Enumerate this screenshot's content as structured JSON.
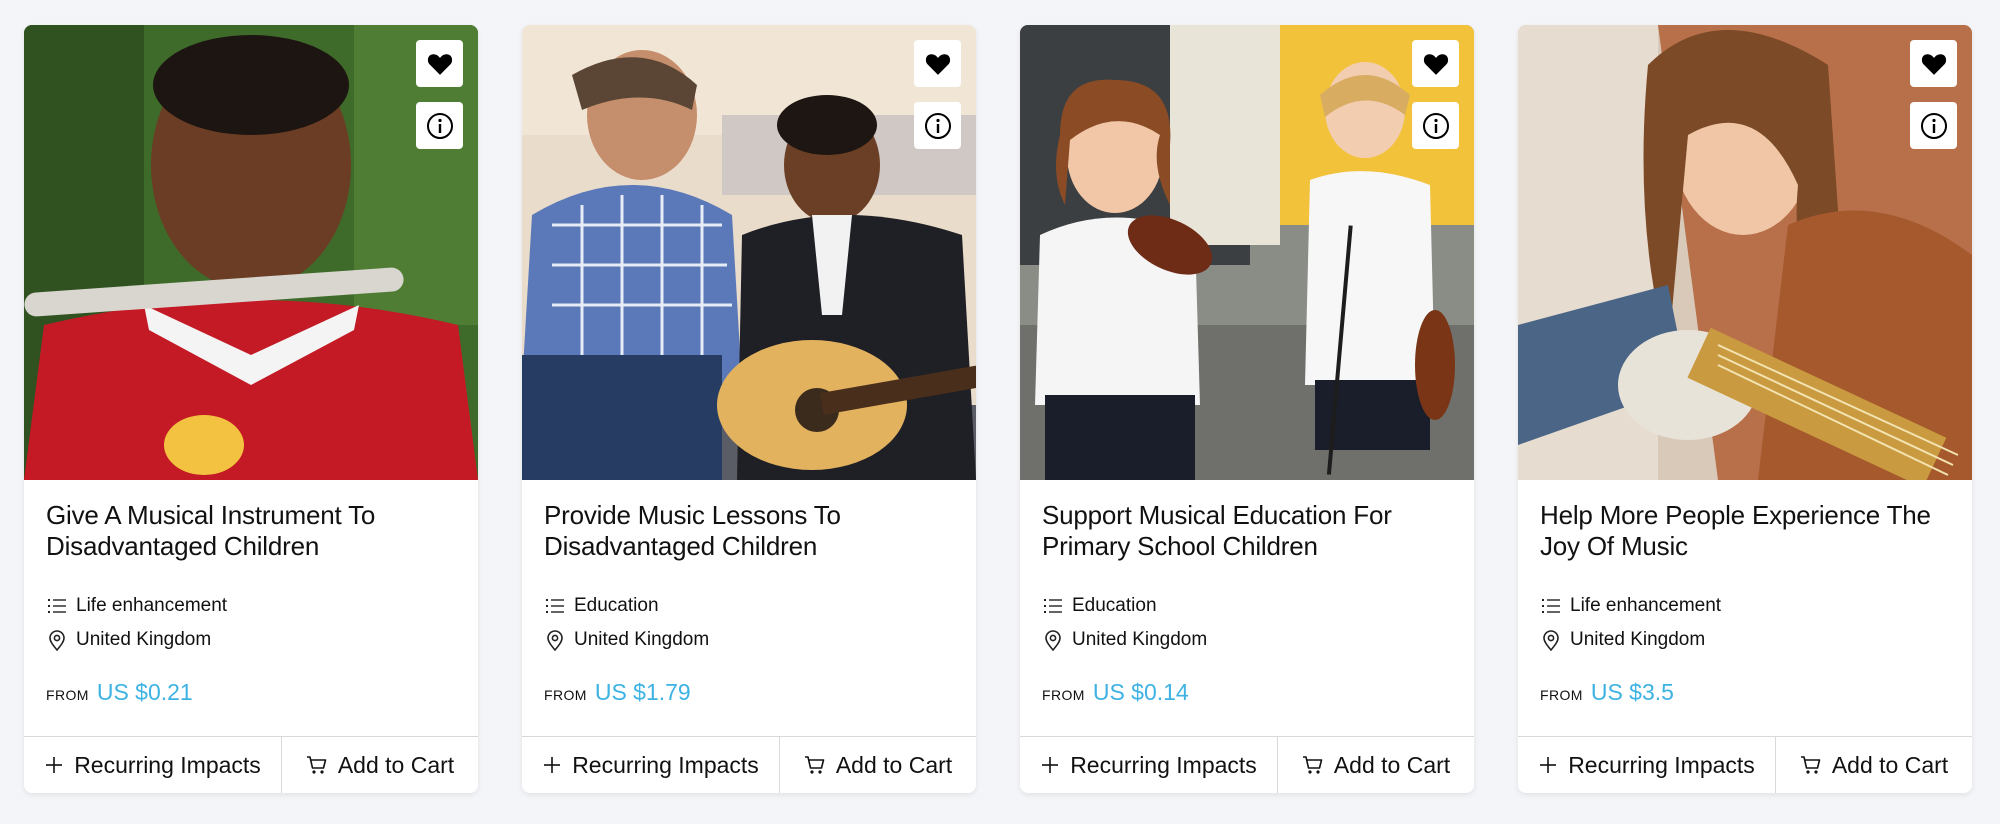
{
  "cards": [
    {
      "title": "Give A Musical Instrument To Disadvantaged Children",
      "category": "Life enhancement",
      "location": "United Kingdom",
      "from_label": "FROM",
      "price": "US $0.21",
      "recurring_label": "Recurring Impacts",
      "cart_label": "Add to Cart",
      "image": "boy-playing-flute"
    },
    {
      "title": "Provide Music Lessons To Disadvantaged Children",
      "category": "Education",
      "location": "United Kingdom",
      "from_label": "FROM",
      "price": "US $1.79",
      "recurring_label": "Recurring Impacts",
      "cart_label": "Add to Cart",
      "image": "teacher-guitar-lesson"
    },
    {
      "title": "Support Musical Education For Primary School Children",
      "category": "Education",
      "location": "United Kingdom",
      "from_label": "FROM",
      "price": "US $0.14",
      "recurring_label": "Recurring Impacts",
      "cart_label": "Add to Cart",
      "image": "children-with-violins"
    },
    {
      "title": "Help More People Experience The Joy Of Music",
      "category": "Life enhancement",
      "location": "United Kingdom",
      "from_label": "FROM",
      "price": "US $3.5",
      "recurring_label": "Recurring Impacts",
      "cart_label": "Add to Cart",
      "image": "woman-electric-guitar"
    }
  ],
  "colors": {
    "accent": "#3db2e3",
    "background": "#f4f5f8",
    "card": "#ffffff",
    "divider": "#d9d9d9"
  },
  "icons": [
    "heart-icon",
    "info-icon",
    "list-icon",
    "location-pin-icon",
    "plus-icon",
    "cart-icon"
  ]
}
